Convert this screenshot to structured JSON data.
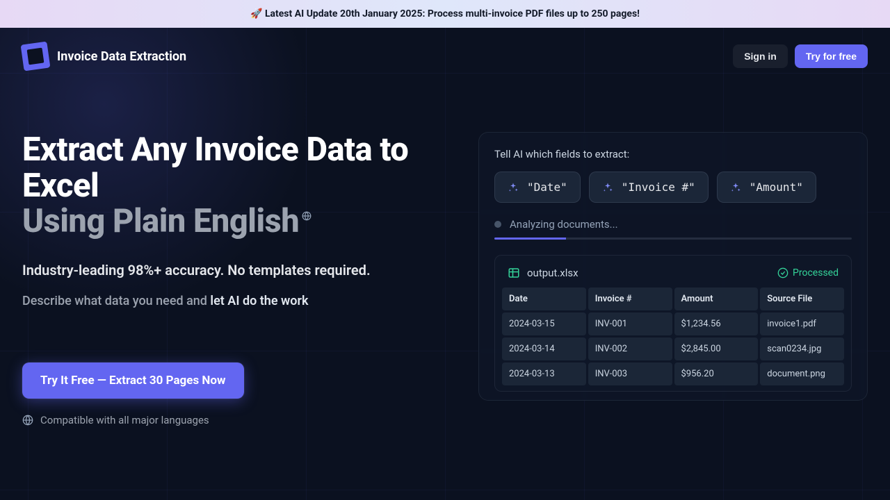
{
  "banner": {
    "text": "🚀 Latest AI Update 20th January 2025: Process multi-invoice PDF files up to 250 pages!"
  },
  "nav": {
    "brand": "Invoice Data Extraction",
    "signin": "Sign in",
    "tryfree": "Try for free"
  },
  "hero": {
    "title_line1": "Extract Any Invoice Data to Excel",
    "title_line2": "Using Plain English",
    "lead": "Industry-leading 98%+ accuracy. No templates required.",
    "desc_prefix": "Describe what data you need and ",
    "desc_strong": "let AI do the work",
    "cta": "Try It Free — Extract 30 Pages Now",
    "compat": "Compatible with all major languages"
  },
  "demo": {
    "prompt_label": "Tell AI which fields to extract:",
    "chips": [
      "\"Date\"",
      "\"Invoice #\"",
      "\"Amount\""
    ],
    "status": "Analyzing documents...",
    "progress_pct": 20,
    "output_file": "output.xlsx",
    "output_status": "Processed",
    "columns": [
      "Date",
      "Invoice #",
      "Amount",
      "Source File"
    ],
    "rows": [
      [
        "2024-03-15",
        "INV-001",
        "$1,234.56",
        "invoice1.pdf"
      ],
      [
        "2024-03-14",
        "INV-002",
        "$2,845.00",
        "scan0234.jpg"
      ],
      [
        "2024-03-13",
        "INV-003",
        "$956.20",
        "document.png"
      ]
    ]
  }
}
